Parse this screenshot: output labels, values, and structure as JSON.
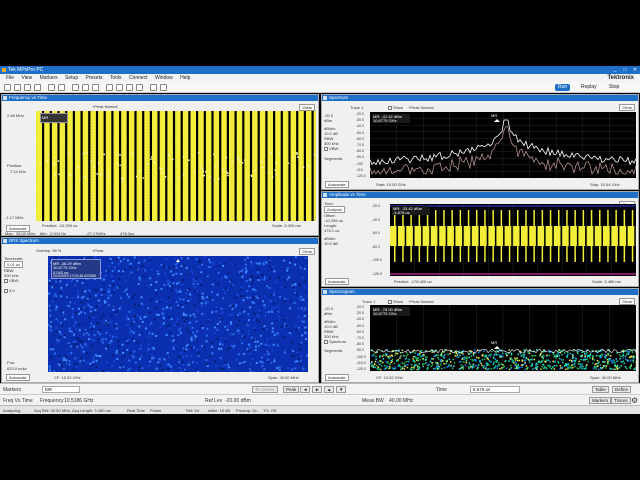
{
  "window": {
    "title": "Tek MPxPro PC",
    "min": "_",
    "max": "□",
    "close": "✕"
  },
  "menu": {
    "items": [
      "File",
      "View",
      "Markers",
      "Setup",
      "Presets",
      "Tools",
      "Connect",
      "Window",
      "Help"
    ],
    "brand": "Tektronix"
  },
  "toolbar": {
    "run_label": "Run",
    "replay_label": "Replay",
    "stop_label": "Stop"
  },
  "fvt": {
    "title": "Frequency vs Time",
    "clear": "Clear",
    "trace_label": "+Peak Normal",
    "top_freq": "2.68 MHz",
    "position_label": "Position:",
    "position_value": "7.14 kHz",
    "bottom_freq": "-1.17 MHz",
    "autoscale": "Autoscale",
    "max_label": "Max:",
    "max_value": "35.00 MHz",
    "min_label": "Min:",
    "bottom_vals": [
      "2.004 Hz",
      "-27.17MHz",
      "478.3us"
    ],
    "pos_label": "Position: -10.259 us",
    "scale_label": "Scale: 3.000 ms",
    "marker_label": "MR"
  },
  "dpx": {
    "title": "DPX Spectrum",
    "overlap": "Overlap: 98 %",
    "trace_label": "+Peak",
    "clear": "Clear",
    "timescale_label": "Timescale:",
    "timescale_value": "0.01 us",
    "rbw_label": "RBW:",
    "rbw_value": "300 kHz",
    "vbw_label": "VBW:",
    "val_3": "3.0",
    "pos_label": "Pos:",
    "pos_value": "623.0 mdiv",
    "autoscale": "Autoscale",
    "marker_box": [
      "MR -36.29 dBm",
      "10.6775 GHz",
      "0.043 us",
      "2/10/2019 17:02:48.623088"
    ],
    "cf": "CF: 10.52 GHz",
    "span": "Span: 40.00 MHz"
  },
  "spec1": {
    "title": "Spectrum",
    "trace": "Trace 1",
    "show": "Show",
    "trace_mode": "+Peak Normal",
    "clear": "Clear",
    "ref": "-20.0",
    "unit": "dBm",
    "dbdiv_label": "dB/div:",
    "dbdiv_value": "10.0 dB",
    "rbw_label": "RBW:",
    "rbw_value": "300 kHz",
    "vbw_label": "VBW:",
    "segments_label": "Segments:",
    "autoscale": "Autoscale",
    "marker": [
      "MR: -41.42 dBm",
      "10.6775 GHz"
    ],
    "yticks": [
      "-20.0",
      "-30.0",
      "-40.0",
      "-50.0",
      "-60.0",
      "-70.0",
      "-80.0",
      "-90.0",
      "-100",
      "-110",
      "-120.0"
    ],
    "start": "Start: 10.50 GHz",
    "stop": "Stop: 10.54 GHz",
    "marker_label": "MR"
  },
  "amp": {
    "title": "Amplitude vs Time",
    "time_label": "Time:",
    "time_value": "Analysis",
    "offset_label": "Offset:",
    "offset_value": "-10.259 us",
    "length_label": "Length:",
    "length_value": "478.1 us",
    "dbdiv_label": "dB/div:",
    "dbdiv_value": "10.0 dB",
    "ref": "-20.0",
    "clear": "Clear",
    "autoscale": "Autoscale",
    "marker": [
      "MR: -33.42 dBm",
      "-4.878 us"
    ],
    "yticks": [
      "-20.0",
      "-40.0",
      "-60.0",
      "-80.0",
      "-100.0",
      "-120.0"
    ],
    "position": "Position: -178.420 us",
    "scale": "Scale: 3.480 ms"
  },
  "spec2": {
    "title": "Spectrogram",
    "trace": "Trace 1",
    "show": "Show",
    "trace_mode": "+Peak Normal",
    "clear": "Clear",
    "ref": "-20.0",
    "unit": "dBm",
    "dbdiv_label": "dB/div:",
    "dbdiv_value": "10.0 dB",
    "rbw_label": "RBW:",
    "rbw_value": "300 kHz",
    "spectrum_label": "Spectrum",
    "segments_label": "Segments:",
    "autoscale": "Autoscale",
    "marker": [
      "MR: -78.00 dBm",
      "10.6775 GHz"
    ],
    "yticks": [
      "-20.0",
      "-30.0",
      "-40.0",
      "-50.0",
      "-60.0",
      "-70.0",
      "-80.0",
      "-90.0",
      "-100.0",
      "-110.0",
      "-120.0"
    ],
    "cf": "CF: 10.52 GHz",
    "span": "Span: 40.00 MHz",
    "marker_label": "MR"
  },
  "markers_bar": {
    "markers_label": "Markers",
    "marker_select": "MR",
    "to_center": "To Center",
    "peak": "Peak",
    "time_label": "Time",
    "time_value": "8.679 us",
    "table": "Table",
    "define": "Define"
  },
  "meas_bar": {
    "measure": "Freq Vs Time",
    "freq_label": "Frequency",
    "freq_value": "10.5186 GHz",
    "ref_label": "Ref Lev",
    "ref_value": "-20.00 dBm",
    "measbw_label": "Meas BW",
    "measbw_value": "40.00 MHz",
    "markers_btn": "Markers",
    "traces_btn": "Traces"
  },
  "status": {
    "items": [
      "Analyzing",
      "Acq BW: 40.00 MHz, Acq Length: 3.480 ms",
      "Real Time",
      "Power",
      "Ref: Int",
      "Atten: 15 dB",
      "Preamp: On",
      "TG: Off"
    ]
  },
  "colors": {
    "accent": "#1e6fc8",
    "yellow": "#f2ee3a",
    "trace_white": "#ffffff"
  }
}
